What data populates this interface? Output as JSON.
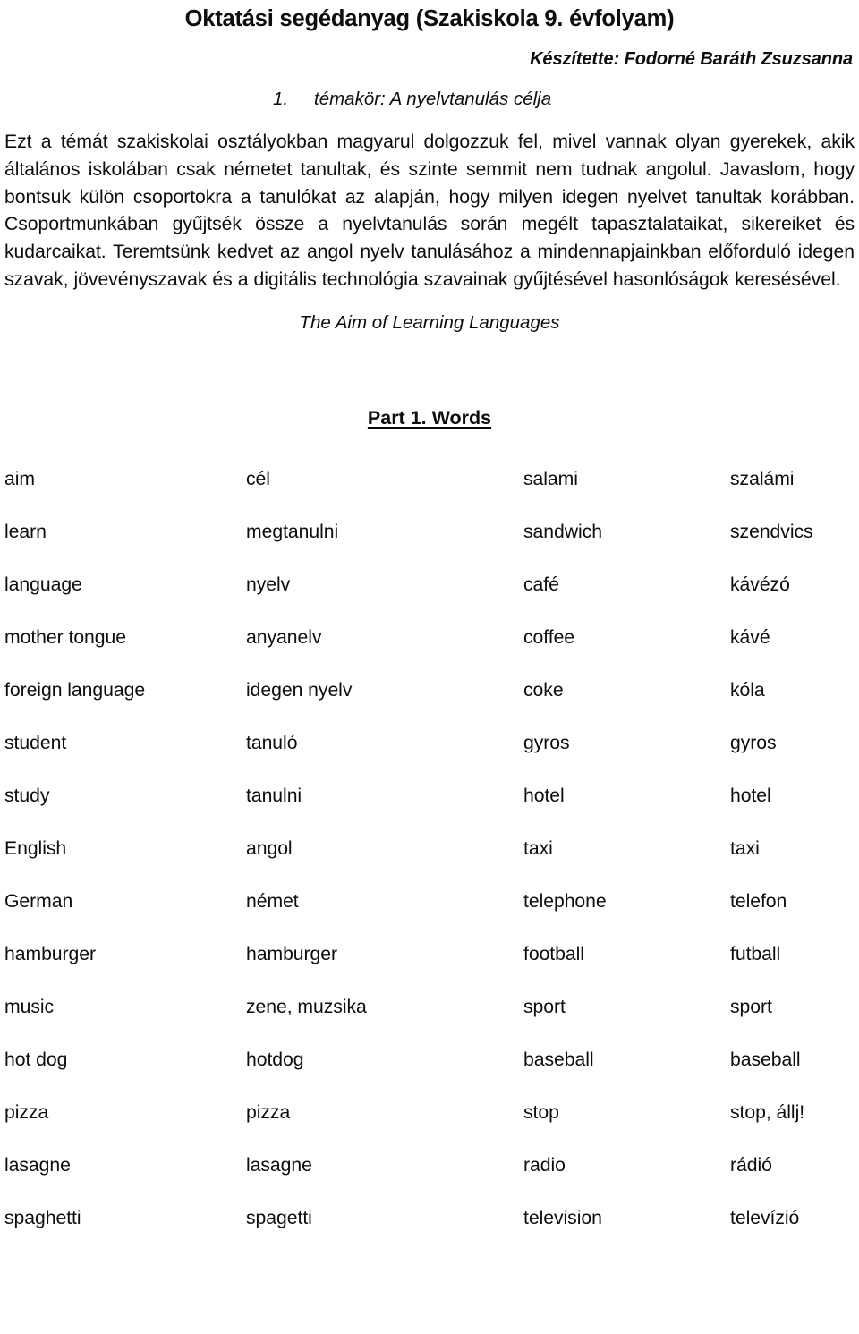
{
  "document": {
    "title": "Oktatási segédanyag (Szakiskola 9. évfolyam)",
    "author_line": "Készítette: Fodorné Baráth Zsuzsanna",
    "topic_number": "1.",
    "topic_title": "témakör: A nyelvtanulás célja",
    "body_paragraph": "Ezt a témát szakiskolai osztályokban magyarul dolgozzuk fel, mivel vannak olyan gyerekek, akik általános iskolában csak németet tanultak, és szinte semmit nem tudnak angolul. Javaslom, hogy bontsuk külön csoportokra a tanulókat az alapján, hogy milyen idegen nyelvet tanultak korábban. Csoportmunkában gyűjtsék össze a nyelvtanulás során megélt tapasztalataikat, sikereiket és kudarcaikat. Teremtsünk kedvet az angol nyelv tanulásához a mindennapjainkban előforduló idegen szavak, jövevényszavak és a digitális technológia szavainak gyűjtésével hasonlóságok keresésével.",
    "subtitle_english": "The Aim of Learning Languages",
    "part_heading": "Part 1. Words"
  },
  "word_table": {
    "rows": [
      {
        "en_a": "aim",
        "hu_a": "cél",
        "en_b": "salami",
        "hu_b": "szalámi"
      },
      {
        "en_a": "learn",
        "hu_a": "megtanulni",
        "en_b": "sandwich",
        "hu_b": "szendvics"
      },
      {
        "en_a": "language",
        "hu_a": "nyelv",
        "en_b": "café",
        "hu_b": "kávézó"
      },
      {
        "en_a": "mother tongue",
        "hu_a": "anyanelv",
        "en_b": "coffee",
        "hu_b": "kávé"
      },
      {
        "en_a": "foreign language",
        "hu_a": "idegen nyelv",
        "en_b": "coke",
        "hu_b": "kóla"
      },
      {
        "en_a": "student",
        "hu_a": "tanuló",
        "en_b": "gyros",
        "hu_b": "gyros"
      },
      {
        "en_a": "study",
        "hu_a": "tanulni",
        "en_b": "hotel",
        "hu_b": "hotel"
      },
      {
        "en_a": "English",
        "hu_a": "angol",
        "en_b": "taxi",
        "hu_b": "taxi"
      },
      {
        "en_a": "German",
        "hu_a": "német",
        "en_b": "telephone",
        "hu_b": "telefon"
      },
      {
        "en_a": "hamburger",
        "hu_a": "hamburger",
        "en_b": "football",
        "hu_b": "futball"
      },
      {
        "en_a": "music",
        "hu_a": "zene, muzsika",
        "en_b": "sport",
        "hu_b": "sport"
      },
      {
        "en_a": "hot dog",
        "hu_a": "hotdog",
        "en_b": "baseball",
        "hu_b": "baseball"
      },
      {
        "en_a": "pizza",
        "hu_a": "pizza",
        "en_b": "stop",
        "hu_b": "stop, állj!"
      },
      {
        "en_a": "lasagne",
        "hu_a": "lasagne",
        "en_b": "radio",
        "hu_b": "rádió"
      },
      {
        "en_a": "spaghetti",
        "hu_a": "spagetti",
        "en_b": "television",
        "hu_b": "televízió"
      }
    ]
  },
  "colors": {
    "page_background": "#ffffff",
    "text": "#0d0d0d"
  }
}
